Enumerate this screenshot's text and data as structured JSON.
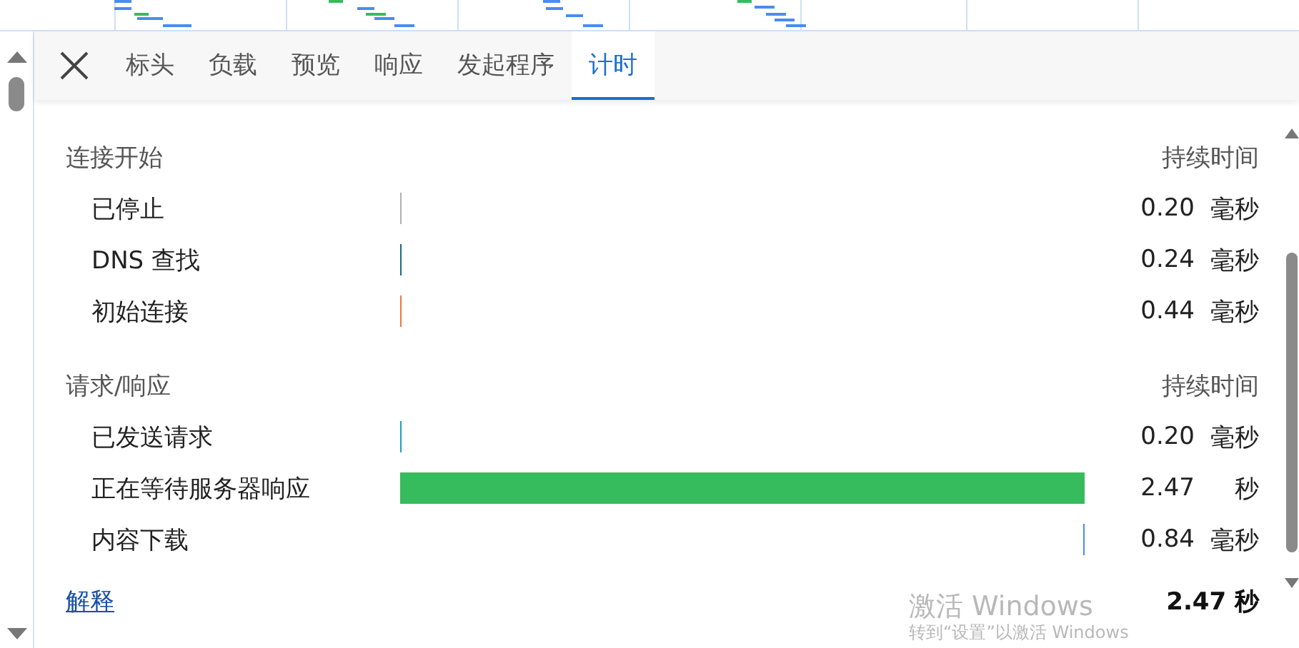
{
  "tabs": [
    {
      "label": "标头",
      "selected": false
    },
    {
      "label": "负载",
      "selected": false
    },
    {
      "label": "预览",
      "selected": false
    },
    {
      "label": "响应",
      "selected": false
    },
    {
      "label": "发起程序",
      "selected": false
    },
    {
      "label": "计时",
      "selected": true
    }
  ],
  "sections": [
    {
      "title": "连接开始",
      "duration_heading": "持续时间",
      "rows": [
        {
          "label": "已停止",
          "color": "#b0b0b0",
          "kind": "tick_start",
          "value": "0.20",
          "unit": "毫秒"
        },
        {
          "label": "DNS 查找",
          "color": "#1a6a80",
          "kind": "tick_start",
          "value": "0.24",
          "unit": "毫秒"
        },
        {
          "label": "初始连接",
          "color": "#f0773a",
          "kind": "tick_start",
          "value": "0.44",
          "unit": "毫秒"
        }
      ]
    },
    {
      "title": "请求/响应",
      "duration_heading": "持续时间",
      "rows": [
        {
          "label": "已发送请求",
          "color": "#1aa0c0",
          "kind": "tick_start",
          "value": "0.20",
          "unit": "毫秒"
        },
        {
          "label": "正在等待服务器响应",
          "color": "#36bc5c",
          "kind": "bar",
          "value": "2.47",
          "unit": "秒"
        },
        {
          "label": "内容下载",
          "color": "#4a8cf0",
          "kind": "tick_end",
          "value": "0.84",
          "unit": "毫秒"
        }
      ]
    }
  ],
  "explain_link": "解释",
  "total": "2.47 秒",
  "os_notice": {
    "title": "激活 Windows",
    "hint": "转到“设置”以激活 Windows"
  }
}
